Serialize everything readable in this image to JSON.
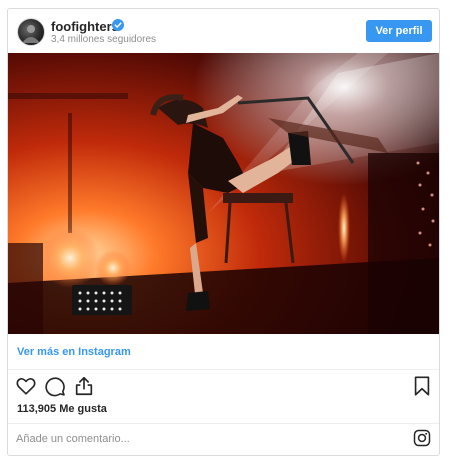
{
  "post": {
    "username": "foofighters",
    "followers": "3,4 millones seguidores",
    "profile_button": "Ver perfil",
    "view_more_link": "Ver más en Instagram",
    "likes": "113,905 Me gusta",
    "comment_placeholder": "Añade un comentario..."
  },
  "icons": {
    "verified": "verified-badge-icon",
    "like": "heart-icon",
    "comment": "comment-bubble-icon",
    "share": "share-icon",
    "save": "bookmark-icon",
    "instagram": "instagram-logo-icon"
  },
  "colors": {
    "accent": "#3897f0",
    "text": "#262626",
    "muted": "#8e8e8e",
    "border": "#dbdbdb"
  }
}
